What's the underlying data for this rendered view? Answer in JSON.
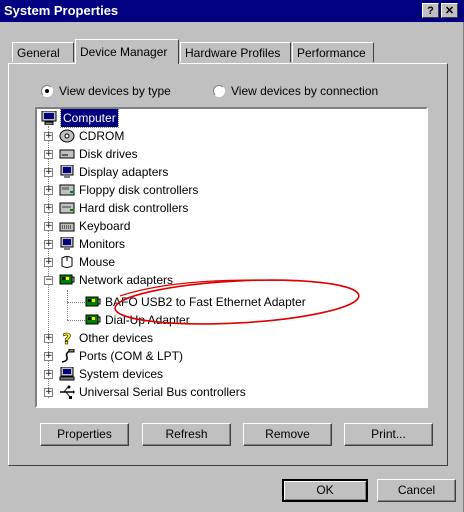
{
  "window": {
    "title": "System Properties",
    "help_label": "?",
    "close_label": "✕"
  },
  "tabs": [
    {
      "label": "General",
      "active": false
    },
    {
      "label": "Device Manager",
      "active": true
    },
    {
      "label": "Hardware Profiles",
      "active": false
    },
    {
      "label": "Performance",
      "active": false
    }
  ],
  "view_options": {
    "by_type": {
      "label": "View devices by type",
      "selected": true
    },
    "by_connection": {
      "label": "View devices by connection",
      "selected": false
    }
  },
  "tree": {
    "root": {
      "label": "Computer",
      "icon": "computer-icon",
      "selected": true
    },
    "items": [
      {
        "label": "CDROM",
        "icon": "cdrom-icon",
        "expander": "+"
      },
      {
        "label": "Disk drives",
        "icon": "disk-drive-icon",
        "expander": "+"
      },
      {
        "label": "Display adapters",
        "icon": "monitor-icon",
        "expander": "+"
      },
      {
        "label": "Floppy disk controllers",
        "icon": "floppy-controller-icon",
        "expander": "+"
      },
      {
        "label": "Hard disk controllers",
        "icon": "hard-disk-controller-icon",
        "expander": "+"
      },
      {
        "label": "Keyboard",
        "icon": "keyboard-icon",
        "expander": "+"
      },
      {
        "label": "Monitors",
        "icon": "monitor-icon",
        "expander": "+"
      },
      {
        "label": "Mouse",
        "icon": "mouse-icon",
        "expander": "+"
      },
      {
        "label": "Network adapters",
        "icon": "network-adapter-icon",
        "expander": "−",
        "children": [
          {
            "label": "BAFO USB2 to Fast Ethernet Adapter",
            "icon": "network-card-icon"
          },
          {
            "label": "Dial-Up Adapter",
            "icon": "network-card-icon"
          }
        ]
      },
      {
        "label": "Other devices",
        "icon": "question-icon",
        "expander": "+"
      },
      {
        "label": "Ports (COM & LPT)",
        "icon": "port-icon",
        "expander": "+"
      },
      {
        "label": "System devices",
        "icon": "system-devices-icon",
        "expander": "+"
      },
      {
        "label": "Universal Serial Bus controllers",
        "icon": "usb-icon",
        "expander": "+"
      }
    ]
  },
  "buttons": {
    "properties": "Properties",
    "refresh": "Refresh",
    "remove": "Remove",
    "print": "Print...",
    "ok": "OK",
    "cancel": "Cancel"
  },
  "annotation": {
    "color": "#e00000"
  },
  "colors": {
    "face": "#c0c0c0",
    "title": "#000080",
    "selection": "#000080"
  }
}
